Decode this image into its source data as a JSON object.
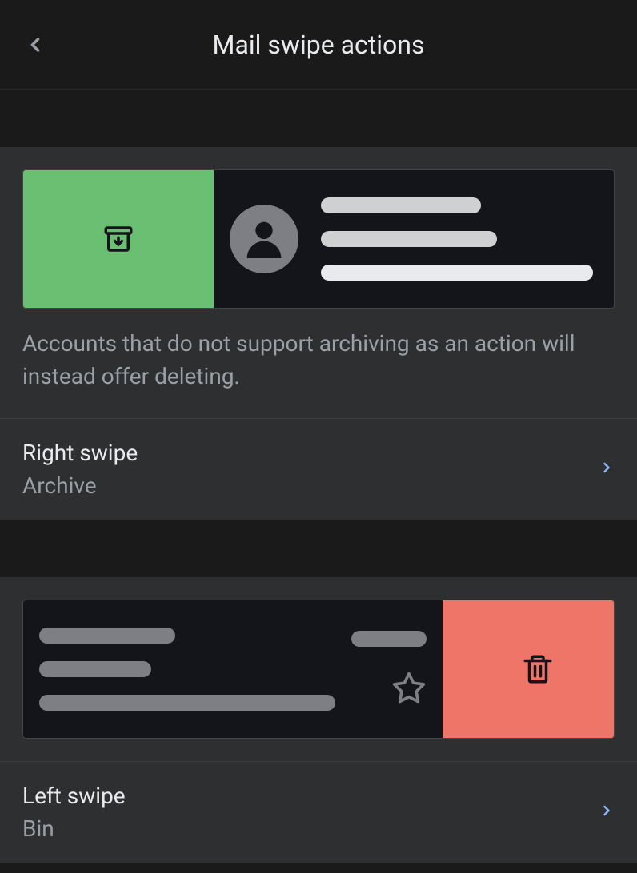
{
  "header": {
    "title": "Mail swipe actions"
  },
  "rightSwipe": {
    "note": "Accounts that do not support archiving as an action will instead offer deleting.",
    "label": "Right swipe",
    "value": "Archive",
    "action_icon": "archive-icon",
    "action_color": "#6bbf73"
  },
  "leftSwipe": {
    "label": "Left swipe",
    "value": "Bin",
    "action_icon": "trash-icon",
    "action_color": "#ee7568"
  }
}
